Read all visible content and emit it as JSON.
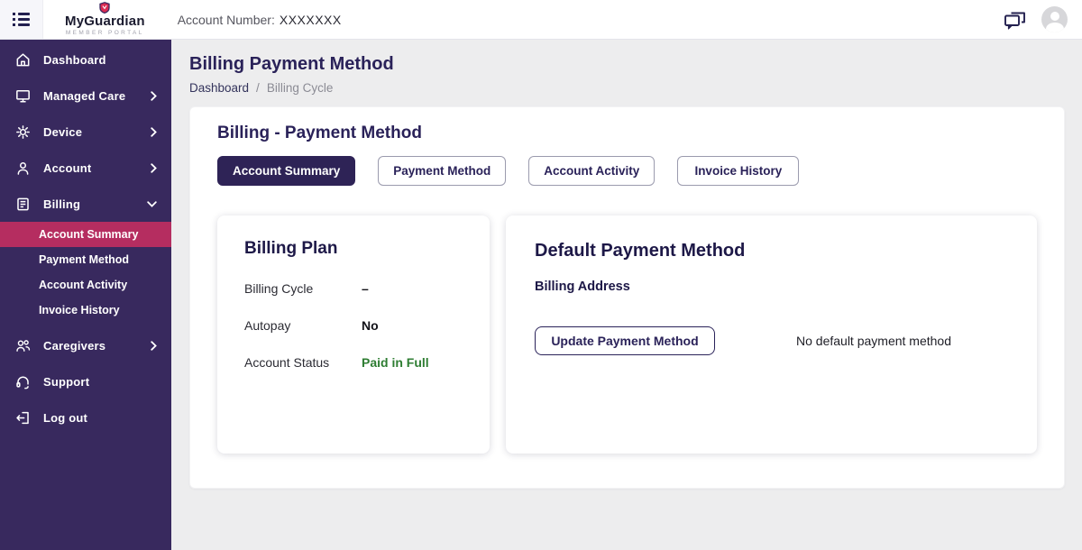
{
  "colors": {
    "sidebar_bg": "#38295e",
    "active_item_bg": "#b52d60",
    "accent_dark": "#2e2356",
    "status_green": "#2e7d32",
    "content_bg": "#ededee"
  },
  "header": {
    "brand": "MyGuardian",
    "brand_sub": "MEMBER PORTAL",
    "account_label": "Account Number:",
    "account_value": "XXXXXXX",
    "icons": [
      "menu-list-icon",
      "shield-logo-icon",
      "chat-icon",
      "avatar-icon"
    ]
  },
  "sidebar": {
    "items": [
      {
        "label": "Dashboard",
        "icon": "home"
      },
      {
        "label": "Managed Care",
        "icon": "monitor",
        "chevron": "right"
      },
      {
        "label": "Device",
        "icon": "gear",
        "chevron": "right"
      },
      {
        "label": "Account",
        "icon": "user",
        "chevron": "right"
      },
      {
        "label": "Billing",
        "icon": "billing",
        "chevron": "down",
        "expanded": true
      },
      {
        "label": "Caregivers",
        "icon": "people",
        "chevron": "right"
      },
      {
        "label": "Support",
        "icon": "headset"
      },
      {
        "label": "Log out",
        "icon": "logout"
      }
    ],
    "billing_subitems": [
      {
        "label": "Account Summary",
        "active": true
      },
      {
        "label": "Payment Method"
      },
      {
        "label": "Account Activity"
      },
      {
        "label": "Invoice History"
      }
    ]
  },
  "main": {
    "page_title": "Billing Payment Method",
    "breadcrumb": {
      "root": "Dashboard",
      "separator": "/",
      "current": "Billing Cycle"
    },
    "card": {
      "title": "Billing - Payment Method",
      "tabs": [
        {
          "label": "Account Summary",
          "active": true
        },
        {
          "label": "Payment Method"
        },
        {
          "label": "Account Activity"
        },
        {
          "label": "Invoice History"
        }
      ],
      "billing_plan": {
        "title": "Billing Plan",
        "rows": [
          {
            "label": "Billing Cycle",
            "value": "–"
          },
          {
            "label": "Autopay",
            "value": "No"
          },
          {
            "label": "Account Status",
            "value": "Paid in Full",
            "status": "positive"
          }
        ]
      },
      "default_payment": {
        "title": "Default Payment Method",
        "subheading": "Billing Address",
        "update_button": "Update Payment Method",
        "empty_text": "No default payment method"
      }
    }
  }
}
